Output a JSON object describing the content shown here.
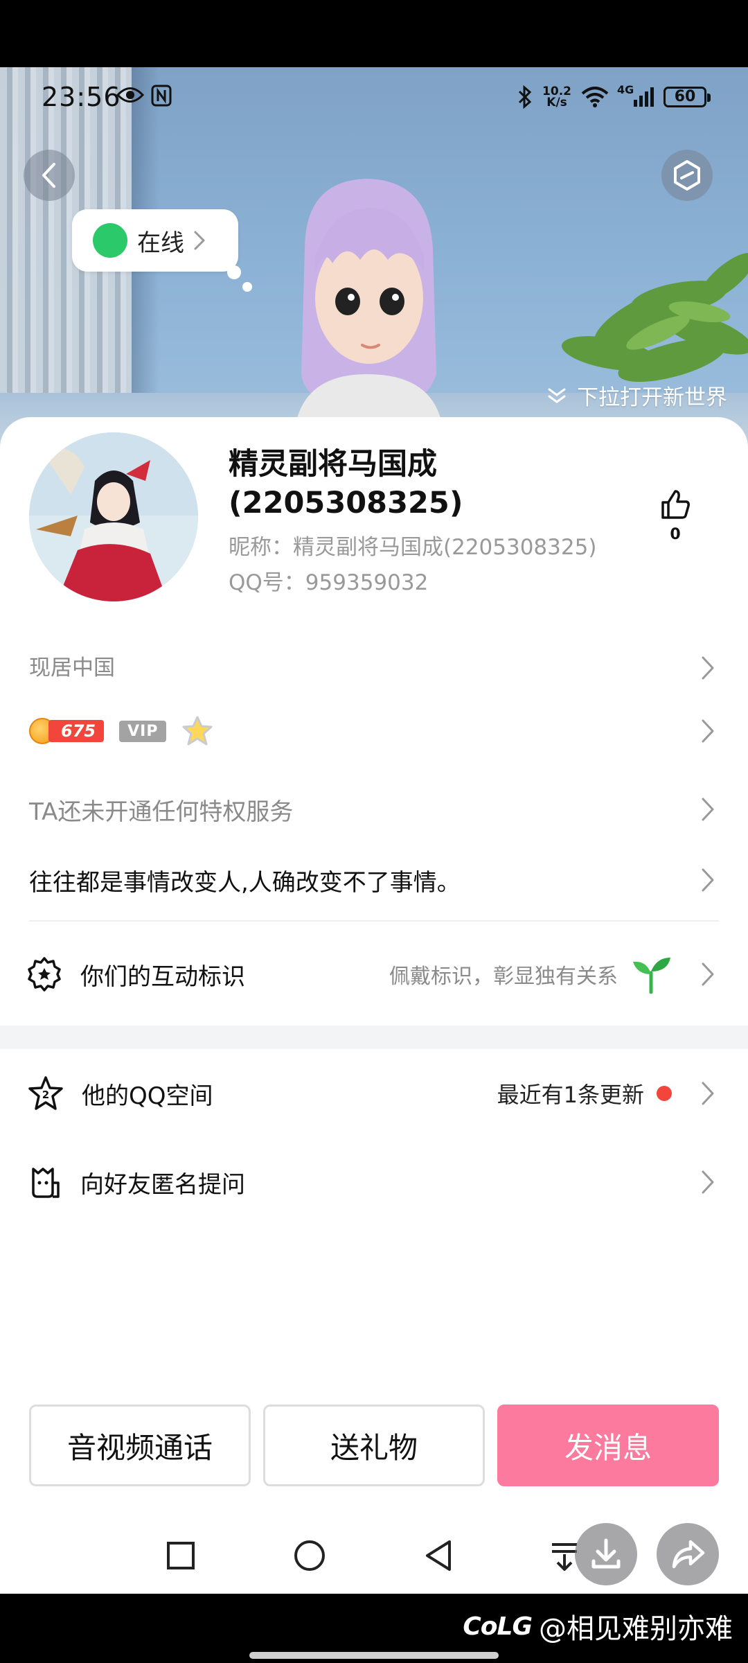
{
  "status_bar": {
    "time": "23:56",
    "net_speed_value": "10.2",
    "net_speed_unit": "K/s",
    "network": "4G",
    "battery": "60",
    "icons": [
      "eye-icon",
      "nfc-icon",
      "bluetooth-icon",
      "wifi-icon",
      "signal-icon",
      "battery-icon"
    ]
  },
  "hero": {
    "online_status": "在线",
    "pull_hint": "下拉打开新世界"
  },
  "profile": {
    "name": "精灵副将马国成(2205308325)",
    "nickname": "昵称：精灵副将马国成(2205308325)",
    "qq_number": "QQ号：959359032",
    "likes": "0"
  },
  "rows": {
    "location": "现居中国",
    "level_score": "675",
    "vip_label": "VIP",
    "privilege": "TA还未开通任何特权服务",
    "signature": "往往都是事情改变人,人确改变不了事情。",
    "interaction_label": "你们的互动标识",
    "interaction_hint": "佩戴标识，彰显独有关系",
    "qzone_label": "他的QQ空间",
    "qzone_hint": "最近有1条更新",
    "ask_label": "向好友匿名提问"
  },
  "actions": {
    "call": "音视频通话",
    "gift": "送礼物",
    "message": "发消息"
  },
  "watermark": {
    "logo": "CoLG",
    "handle": "@相见难别亦难"
  },
  "colors": {
    "accent_pink": "#fb7a9d",
    "online_green": "#2cc96b",
    "badge_red": "#f2453b"
  }
}
